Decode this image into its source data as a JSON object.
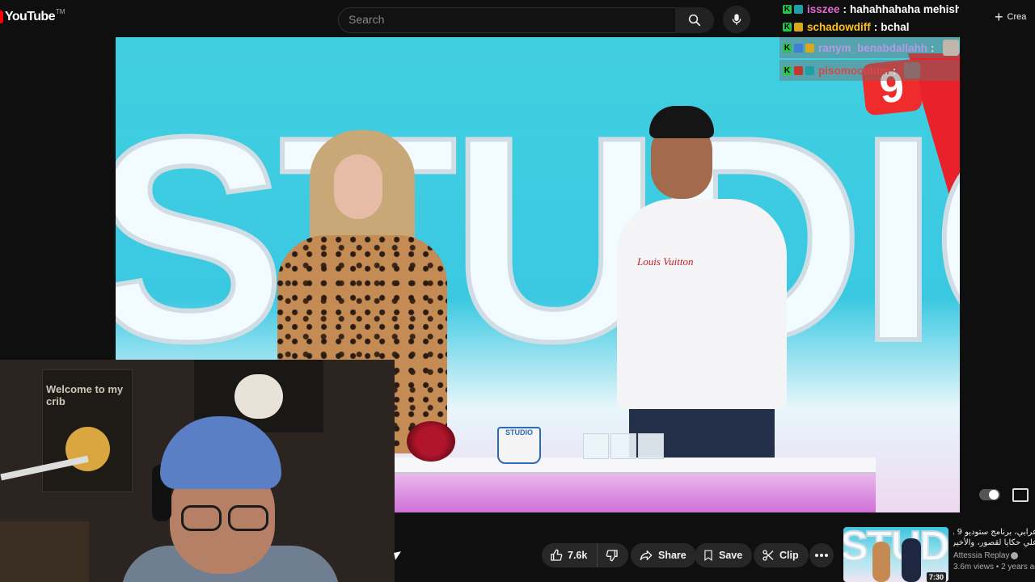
{
  "header": {
    "logo_text": "YouTube",
    "logo_tm": "TM",
    "search_placeholder": "Search",
    "create_label": "Crea"
  },
  "chat": [
    {
      "user": "isszee",
      "sep": ":",
      "message": "hahahhahaha mehish hiya?",
      "user_color": "#e56ad0",
      "badges": [
        "k",
        "gear"
      ],
      "dim": false
    },
    {
      "user": "schadowdiff",
      "sep": ":",
      "message": "bchal",
      "user_color": "#ffc21a",
      "badges": [
        "k",
        "gold"
      ],
      "dim": false
    },
    {
      "user": "ranym_benabdallahh",
      "sep": ":",
      "message": "",
      "user_color": "#b39be6",
      "badges": [
        "k",
        "blue",
        "gold"
      ],
      "dim": true
    },
    {
      "user": "pisomoculum",
      "sep": ":",
      "message": "",
      "user_color": "#d8484a",
      "badges": [
        "k",
        "red",
        "gear"
      ],
      "dim": true
    }
  ],
  "video": {
    "set_word": "STUDIO",
    "channel_logo": "9",
    "shirt_brand": "Louis Vuitton",
    "mug_text": "STUDIO"
  },
  "webcam": {
    "flag_text": "Welcome to my crib"
  },
  "actions": {
    "like_count": "7.6k",
    "share_label": "Share",
    "save_label": "Save",
    "clip_label": "Clip"
  },
  "recommended": {
    "title_line1": "عرابي، برنامج ستوديو 9 وكشف",
    "title_line2": "علي حكايا لقصور، والأخير يتفاعل",
    "channel": "Attessia Replay",
    "meta": "3.6m views • 2 years ago",
    "duration": "7:30",
    "thumb_word": "STUDIO"
  },
  "colors": {
    "brand_red": "#ff0000",
    "bg": "#0f0f0f",
    "pill_bg": "#272727"
  }
}
